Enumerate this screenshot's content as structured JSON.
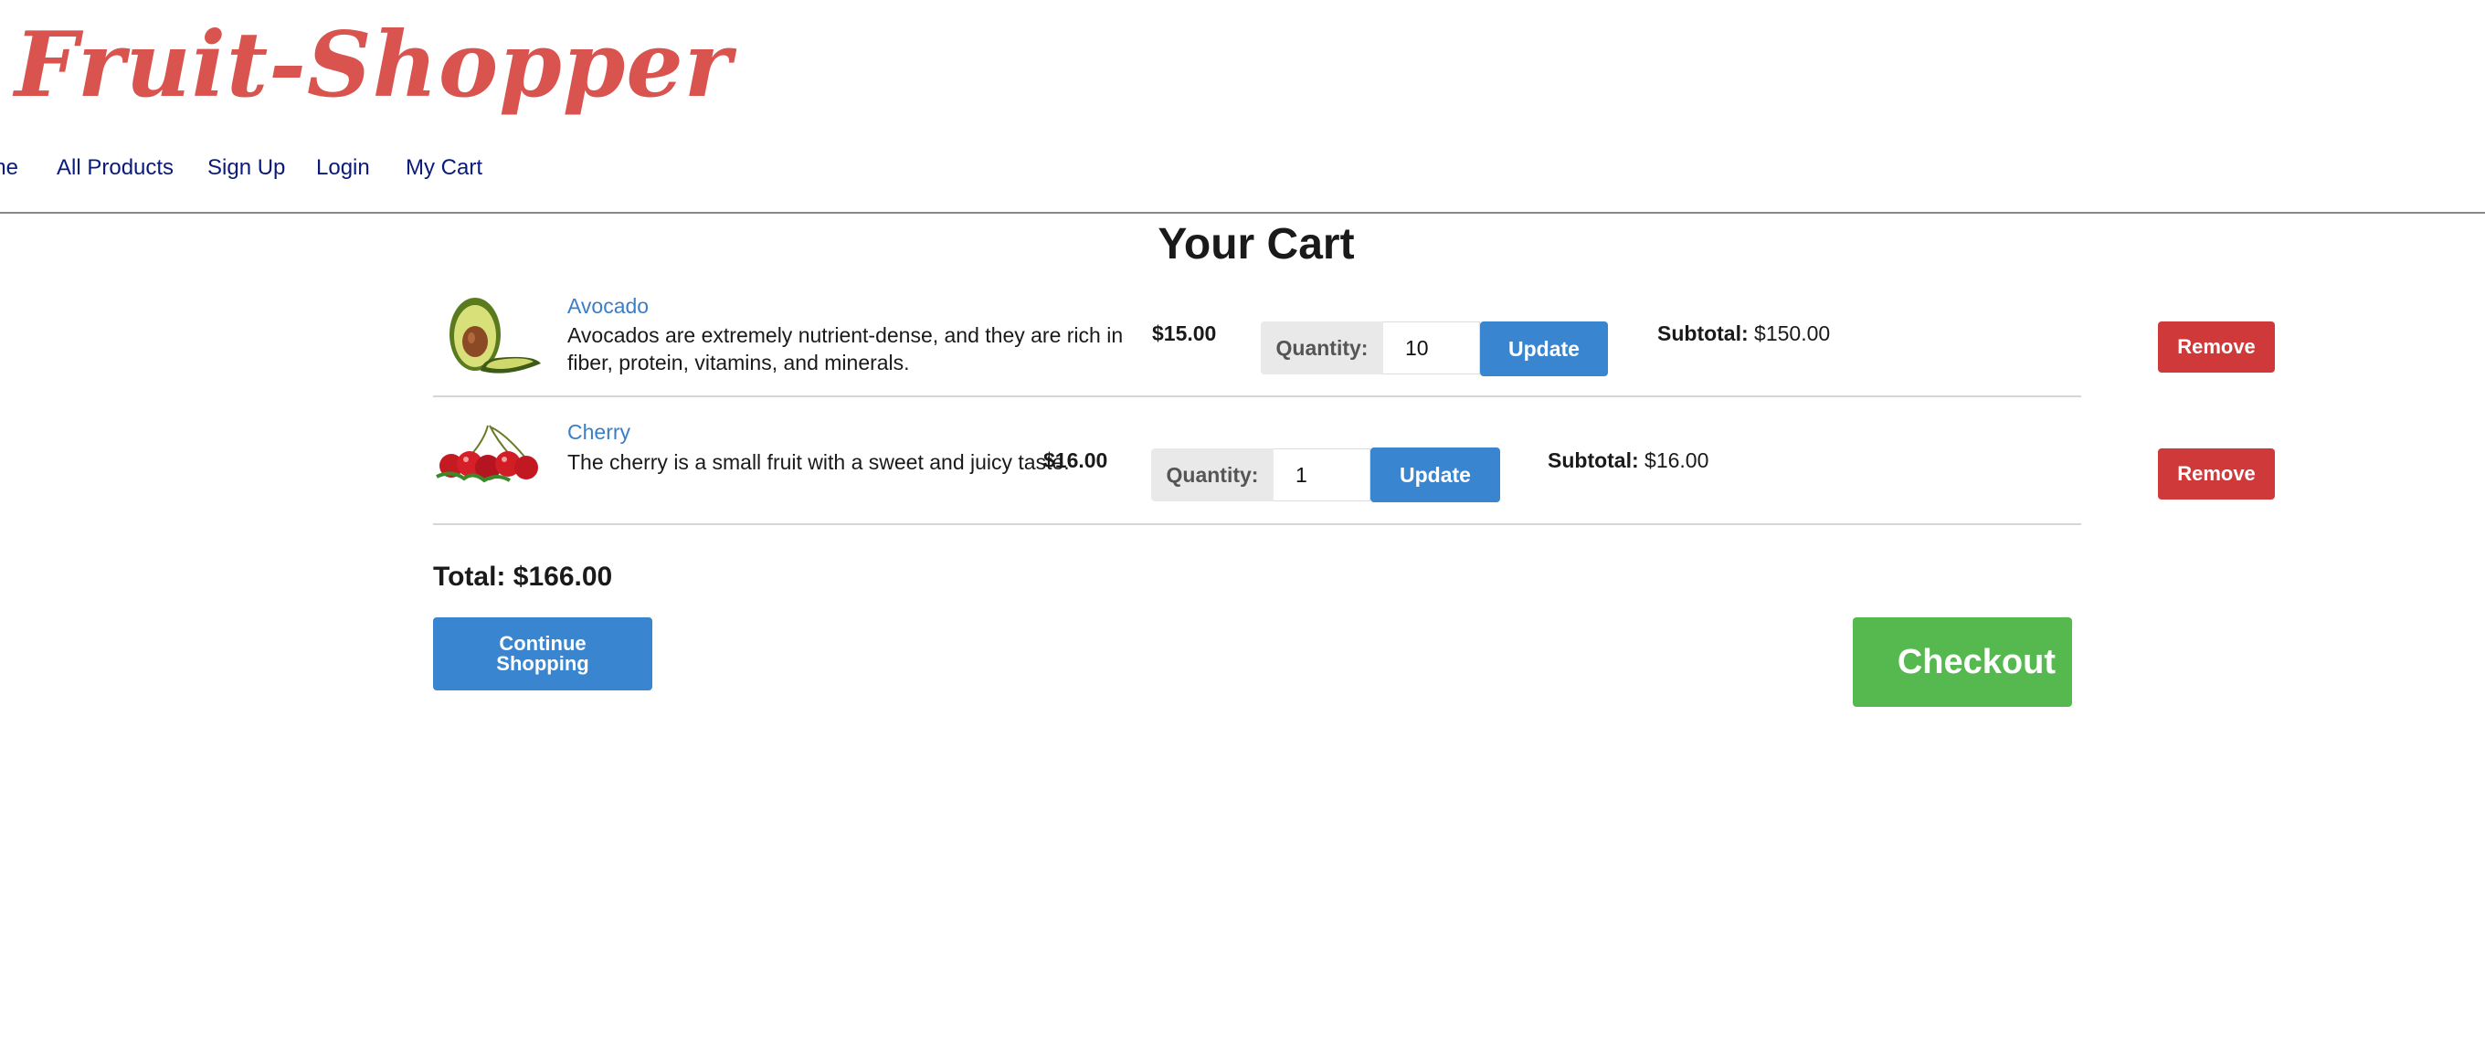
{
  "header": {
    "logo": "Fruit-Shopper",
    "nav": [
      "Home",
      "All Products",
      "Sign Up",
      "Login",
      "My Cart"
    ]
  },
  "cart": {
    "title": "Your Cart",
    "quantity_label": "Quantity:",
    "update_label": "Update",
    "subtotal_label": "Subtotal:",
    "remove_label": "Remove",
    "items": [
      {
        "name": "Avocado",
        "description": "Avocados are extremely nutrient-dense, and they are rich in fiber, protein, vitamins, and minerals.",
        "price": "$15.00",
        "quantity": "10",
        "subtotal": "$150.00"
      },
      {
        "name": "Cherry",
        "description": "The cherry is a small fruit with a sweet and juicy taste.",
        "price": "$16.00",
        "quantity": "1",
        "subtotal": "$16.00"
      }
    ],
    "total": "Total: $166.00",
    "continue_label": "Continue Shopping",
    "checkout_label": "Checkout"
  },
  "colors": {
    "logo": "#d9534f",
    "nav_link": "#0a1a7a",
    "product_link": "#3a7fc6",
    "primary_button": "#3a85d0",
    "danger_button": "#d0393a",
    "success_button": "#55b94f"
  },
  "icons": [
    "avocado-image",
    "cherry-image"
  ]
}
